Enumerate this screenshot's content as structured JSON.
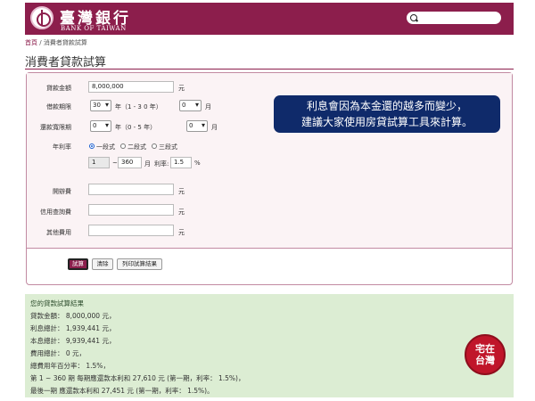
{
  "header": {
    "logo_cn": "臺灣銀行",
    "logo_en": "BANK OF TAIWAN",
    "search_placeholder": ""
  },
  "breadcrumb": {
    "home": "首頁",
    "separator": "/",
    "current": "消費者貸款試算"
  },
  "page_title": "消費者貸款試算",
  "form": {
    "loan_amount": {
      "label": "貸款金額",
      "value": "8,000,000",
      "unit": "元"
    },
    "loan_period": {
      "label": "借款期限",
      "years": "30",
      "years_unit": "年（1 - 3 0 年）",
      "months": "0",
      "months_unit": "月"
    },
    "grace_period": {
      "label": "還款寬限期",
      "years": "0",
      "years_unit": "年（0 - 5 年）",
      "months": "0",
      "months_unit": "月"
    },
    "rate": {
      "label": "年利率",
      "options": [
        "一段式",
        "二段式",
        "三段式"
      ],
      "selected_index": 0,
      "from": "1",
      "tilde": "~",
      "to": "360",
      "month_label": "月",
      "rate_label": "利率:",
      "rate_value": "1.5",
      "percent": "%"
    },
    "opening_fee": {
      "label": "開辦費",
      "value": "",
      "unit": "元"
    },
    "credit_check_fee": {
      "label": "信用查詢費",
      "value": "",
      "unit": "元"
    },
    "other_fee": {
      "label": "其他費用",
      "value": "",
      "unit": "元"
    },
    "buttons": {
      "calculate": "試算",
      "clear": "清除",
      "print": "列印試算結果"
    }
  },
  "callout": {
    "line1": "利息會因為本金還的越多而變少，",
    "line2": "建議大家使用房貸試算工具來計算。"
  },
  "result": {
    "title": "您的貸款試算結果",
    "lines": [
      "貸款金額： 8,000,000 元，",
      "利息總計： 1,939,441 元，",
      "本息總計： 9,939,441 元，",
      "費用總計： 0 元，",
      "總費用年百分率： 1.5%，",
      "第 1 ~ 360 期 每期應還款本利和 27,610 元 (第一期，利率： 1.5%)，",
      "最後一期 應還款本利和 27,451 元 (第一期，利率： 1.5%)。"
    ]
  },
  "stamp": {
    "line1": "宅",
    "line2": "在",
    "line3": "台灣"
  },
  "colors": {
    "brand": "#8c1e4c",
    "callout_bg": "#0f2a6a",
    "result_bg": "#dcedd3",
    "stamp": "#c0152a"
  }
}
